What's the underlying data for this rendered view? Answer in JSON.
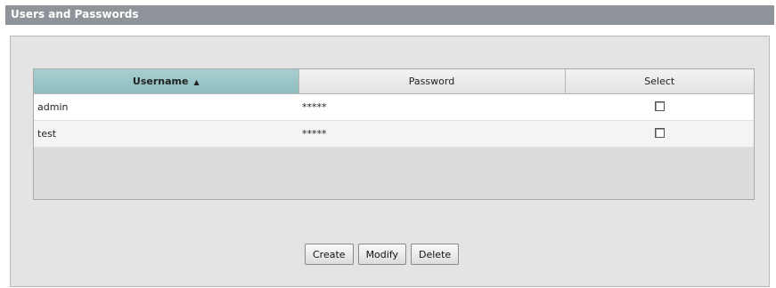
{
  "header": {
    "title": "Users and Passwords"
  },
  "table": {
    "columns": [
      {
        "label": "Username",
        "sort": "ascending"
      },
      {
        "label": "Password"
      },
      {
        "label": "Select"
      }
    ],
    "rows": [
      {
        "username": "admin",
        "password": "*****",
        "selected": false
      },
      {
        "username": "test",
        "password": "*****",
        "selected": false
      }
    ]
  },
  "buttons": {
    "create": "Create",
    "modify": "Modify",
    "delete": "Delete"
  },
  "colors": {
    "title_bar": "#8e9499",
    "sorted_header": "#9fc8c9",
    "panel": "#e4e4e4"
  }
}
